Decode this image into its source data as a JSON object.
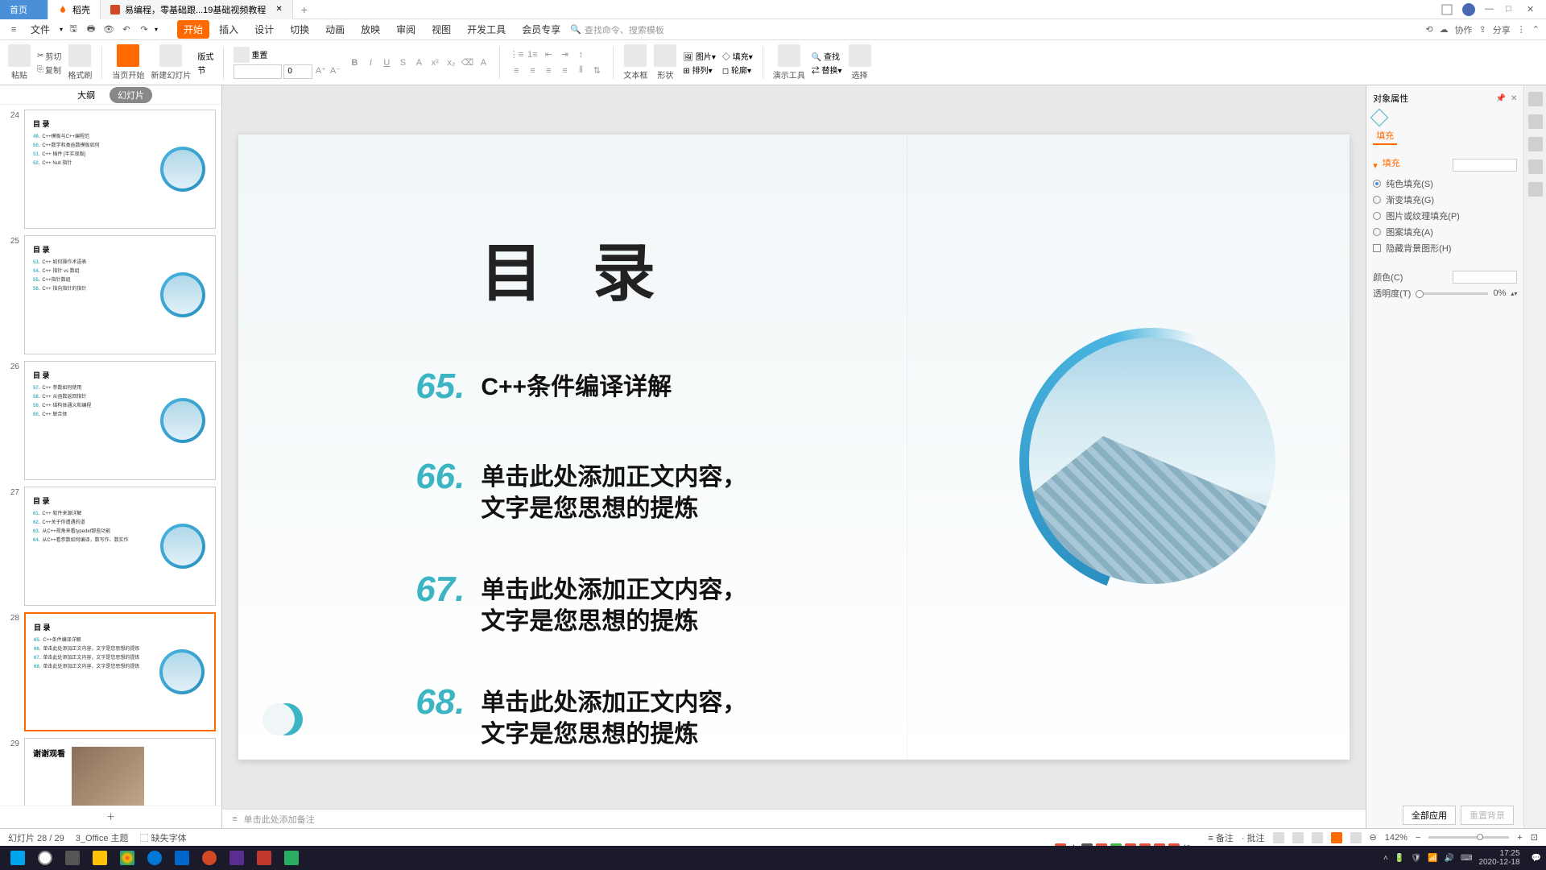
{
  "titlebar": {
    "home_tab": "首页",
    "tab2": "稻壳",
    "tab3": "易编程，零基础跟...19基础视频教程",
    "add": "+"
  },
  "menubar": {
    "file": "文件",
    "items": [
      "开始",
      "插入",
      "设计",
      "切换",
      "动画",
      "放映",
      "审阅",
      "视图",
      "开发工具",
      "会员专享"
    ],
    "search_placeholder": "查找命令、搜索模板",
    "right": {
      "coop": "协作",
      "share": "分享"
    }
  },
  "ribbon": {
    "paste": "粘贴",
    "cut": "剪切",
    "copy": "复制",
    "format_painter": "格式刷",
    "from_begin": "当页开始",
    "new_slide": "新建幻灯片",
    "layout": "版式",
    "section": "节",
    "reset": "重置",
    "font_size": "0",
    "textbox": "文本框",
    "shape": "形状",
    "arrange": "排列",
    "picture": "图片",
    "fill": "填充",
    "tools": "演示工具",
    "find": "查找",
    "replace": "替换",
    "select": "选择"
  },
  "panel": {
    "outline": "大纲",
    "slides": "幻灯片"
  },
  "thumbs": [
    {
      "num": "24",
      "title": "目 录",
      "items": [
        {
          "n": "49.",
          "t": "C++模板与C++编程范"
        },
        {
          "n": "50.",
          "t": "C++数学和类函数模板如何"
        },
        {
          "n": "51.",
          "t": "C++ 插件 [半实现版]"
        },
        {
          "n": "52.",
          "t": "C++ Null 指针"
        }
      ]
    },
    {
      "num": "25",
      "title": "目 录",
      "items": [
        {
          "n": "53.",
          "t": "C++ 如何操作术语表"
        },
        {
          "n": "54.",
          "t": "C++ 指针 vs 数组"
        },
        {
          "n": "55.",
          "t": "C++指针数组"
        },
        {
          "n": "56.",
          "t": "C++ 指向指针的指针"
        }
      ]
    },
    {
      "num": "26",
      "title": "目 录",
      "items": [
        {
          "n": "57.",
          "t": "C++ 参数如何使用"
        },
        {
          "n": "58.",
          "t": "C++ 从函数返回指针"
        },
        {
          "n": "59.",
          "t": "C++ 结构体通义和编程"
        },
        {
          "n": "60.",
          "t": "C++ 联合体"
        }
      ]
    },
    {
      "num": "27",
      "title": "目 录",
      "items": [
        {
          "n": "61.",
          "t": "C++ 软件来源详解"
        },
        {
          "n": "62.",
          "t": "C++关于你遭遇的道"
        },
        {
          "n": "63.",
          "t": "从C++视角来看typedef那些功能"
        },
        {
          "n": "64.",
          "t": "从C++看参数如何编译，数写作、数实作"
        }
      ]
    },
    {
      "num": "28",
      "title": "目 录",
      "items": [
        {
          "n": "65.",
          "t": "C++条件编译详解"
        },
        {
          "n": "66.",
          "t": "单击此处添加正文内容，文字是您思想的提炼"
        },
        {
          "n": "67.",
          "t": "单击此处添加正文内容，文字是您思想的提炼"
        },
        {
          "n": "68.",
          "t": "单击此处添加正文内容，文字是您思想的提炼"
        }
      ],
      "selected": true
    },
    {
      "num": "29",
      "thanks": "谢谢观看"
    }
  ],
  "slide": {
    "title": "目 录",
    "items": [
      {
        "num": "65.",
        "text": "C++条件编译详解"
      },
      {
        "num": "66.",
        "text": "单击此处添加正文内容，\n文字是您思想的提炼"
      },
      {
        "num": "67.",
        "text": "单击此处添加正文内容，\n文字是您思想的提炼"
      },
      {
        "num": "68.",
        "text": "单击此处添加正文内容，\n文字是您思想的提炼"
      }
    ]
  },
  "notes": {
    "placeholder": "单击此处添加备注"
  },
  "props": {
    "title": "对象属性",
    "tab": "填充",
    "section": "填充",
    "opts": {
      "solid": "纯色填充(S)",
      "gradient": "渐变填充(G)",
      "picture": "图片或纹理填充(P)",
      "pattern": "图案填充(A)",
      "hidebg": "隐藏背景图形(H)"
    },
    "color": "颜色(C)",
    "transparency": "透明度(T)",
    "trans_val": "0%",
    "apply_all": "全部应用",
    "reset_bg": "重置背景"
  },
  "status": {
    "slide_info": "幻灯片 28 / 29",
    "theme": "3_Office 主题",
    "missing_font": "缺失字体",
    "notes": "备注",
    "comments": "批注",
    "zoom": "142%"
  },
  "ime": {
    "zh": "中"
  },
  "clock": {
    "time": "17:25",
    "date": "2020-12-18"
  }
}
